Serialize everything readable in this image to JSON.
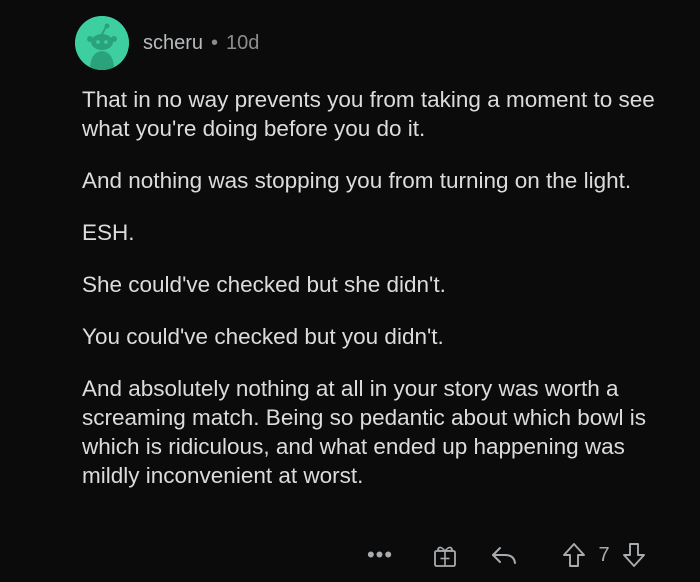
{
  "comment": {
    "username": "scheru",
    "separator": "•",
    "age": "10d",
    "paragraphs": [
      "That in no way prevents you from taking a moment to see what you're doing before you do it.",
      "And nothing was stopping you from turning on the light.",
      "ESH.",
      "She could've checked but she didn't.",
      "You could've checked but you didn't.",
      "And absolutely nothing at all in your story was worth a screaming match. Being so pedantic about which bowl is which is ridiculous, and what ended up happening was mildly inconvenient at worst."
    ],
    "score": "7"
  },
  "actions": {
    "more_label": "•••",
    "icons": [
      "more-icon",
      "award-icon",
      "reply-icon",
      "upvote-icon",
      "downvote-icon"
    ]
  },
  "colors": {
    "background": "#0b0b0b",
    "avatar": "#3ecfa0",
    "text": "#dcdcdc",
    "meta": "#8a8d90"
  }
}
